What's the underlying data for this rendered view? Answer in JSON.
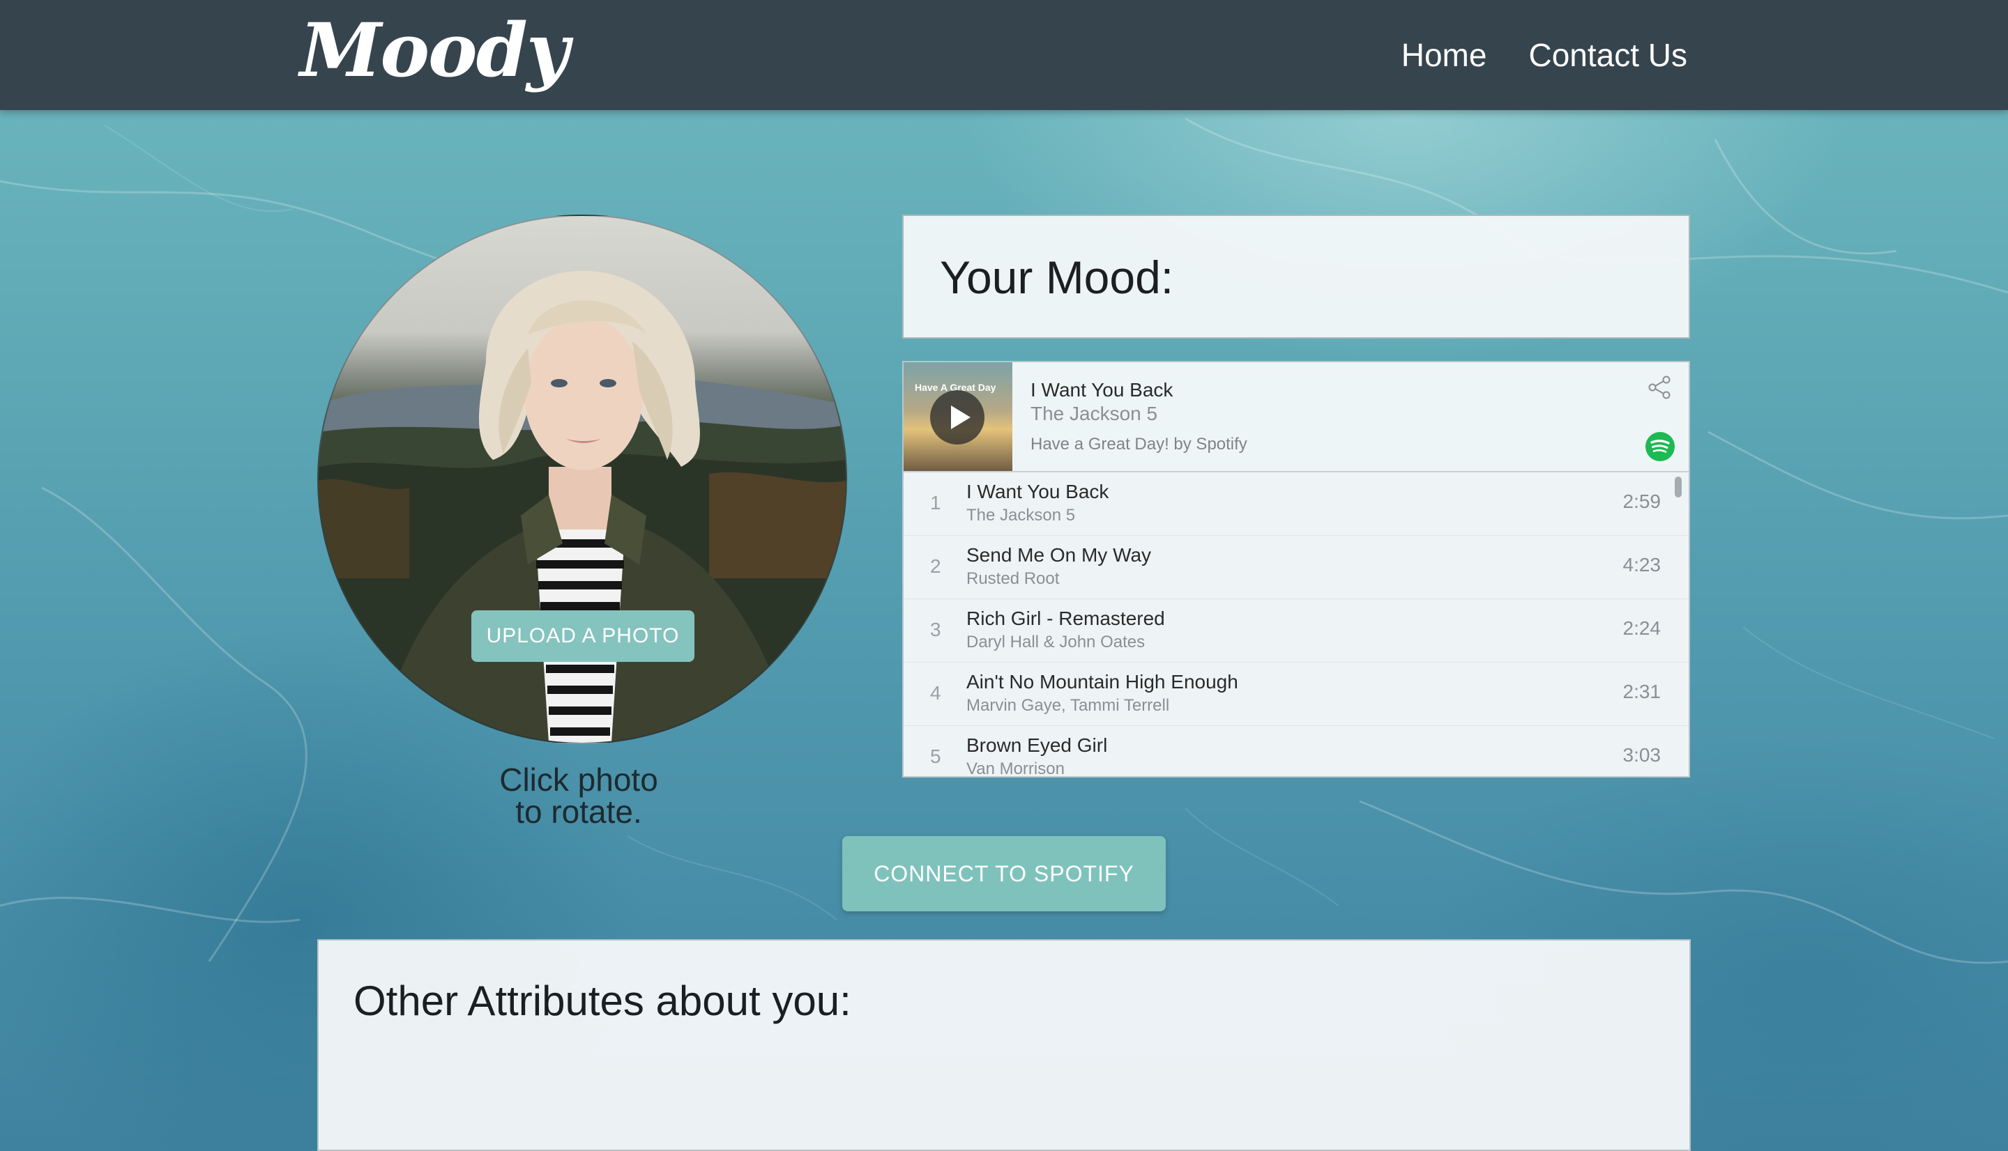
{
  "brand": {
    "logo_text": "Moody"
  },
  "nav": {
    "links": [
      {
        "label": "Home"
      },
      {
        "label": "Contact Us"
      }
    ]
  },
  "photo": {
    "upload_label": "UPLOAD A PHOTO",
    "caption_line1": "Click photo",
    "caption_line2": "to rotate."
  },
  "mood": {
    "title": "Your Mood:"
  },
  "player": {
    "art_text": "Have A Great Day",
    "now_playing": {
      "title": "I Want You Back",
      "artist": "The Jackson 5",
      "playlist": "Have a Great Day! by Spotify"
    },
    "tracks": [
      {
        "num": "1",
        "title": "I Want You Back",
        "artist": "The Jackson 5",
        "duration": "2:59"
      },
      {
        "num": "2",
        "title": "Send Me On My Way",
        "artist": "Rusted Root",
        "duration": "4:23"
      },
      {
        "num": "3",
        "title": "Rich Girl - Remastered",
        "artist": "Daryl Hall & John Oates",
        "duration": "2:24"
      },
      {
        "num": "4",
        "title": "Ain't No Mountain High Enough",
        "artist": "Marvin Gaye, Tammi Terrell",
        "duration": "2:31"
      },
      {
        "num": "5",
        "title": "Brown Eyed Girl",
        "artist": "Van Morrison",
        "duration": "3:03"
      }
    ],
    "icons": {
      "share": "share-icon",
      "spotify": "spotify-logo-icon",
      "play": "play-icon"
    },
    "accent": "#1db954"
  },
  "actions": {
    "connect_label": "CONNECT TO SPOTIFY"
  },
  "attributes": {
    "title": "Other Attributes about you:"
  },
  "colors": {
    "header_bg": "#36444e",
    "button_teal": "#84c3be",
    "panel_bg": "#f4f8f9"
  }
}
